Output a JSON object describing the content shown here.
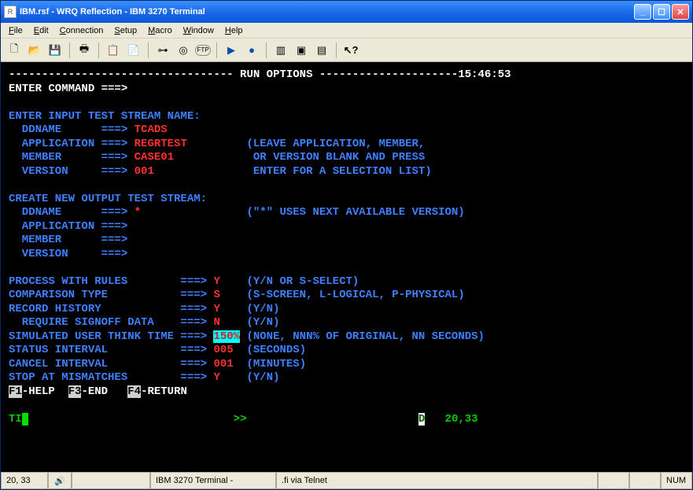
{
  "titlebar": {
    "text": "IBM.rsf - WRQ Reflection - IBM 3270 Terminal",
    "icon_label": "R"
  },
  "menus": {
    "file": {
      "u": "F",
      "rest": "ile"
    },
    "edit": {
      "u": "E",
      "rest": "dit"
    },
    "connection": {
      "u": "C",
      "rest": "onnection"
    },
    "setup": {
      "u": "S",
      "rest": "etup"
    },
    "macro": {
      "u": "M",
      "rest": "acro"
    },
    "window": {
      "u": "W",
      "rest": "indow"
    },
    "help": {
      "u": "H",
      "rest": "elp"
    }
  },
  "term": {
    "title": " RUN OPTIONS ",
    "time": "15:46:53",
    "cmd_label": "ENTER COMMAND ===>",
    "input_header": "ENTER INPUT TEST STREAM NAME:",
    "ddname_l": "  DDNAME      ===> ",
    "ddname_v": "TCADS",
    "app_l": "  APPLICATION ===> ",
    "app_v": "REGRTEST",
    "app_hint": "(LEAVE APPLICATION, MEMBER,",
    "mem_l": "  MEMBER      ===> ",
    "mem_v": "CASE01",
    "mem_hint": " OR VERSION BLANK AND PRESS",
    "ver_l": "  VERSION     ===> ",
    "ver_v": "001",
    "ver_hint": " ENTER FOR A SELECTION LIST)",
    "output_header": "CREATE NEW OUTPUT TEST STREAM:",
    "oddname_l": "  DDNAME      ===> ",
    "oddname_v": "*",
    "oddname_hint": "(\"*\" USES NEXT AVAILABLE VERSION)",
    "oapp_l": "  APPLICATION ===>",
    "omem_l": "  MEMBER      ===>",
    "over_l": "  VERSION     ===>",
    "procrule_l": "PROCESS WITH RULES        ===> ",
    "procrule_v": "Y",
    "procrule_h": "(Y/N OR S-SELECT)",
    "comp_l": "COMPARISON TYPE           ===> ",
    "comp_v": "S",
    "comp_h": "(S-SCREEN, L-LOGICAL, P-PHYSICAL)",
    "rec_l": "RECORD HISTORY            ===> ",
    "rec_v": "Y",
    "rec_h": "(Y/N)",
    "sign_l": "  REQUIRE SIGNOFF DATA    ===> ",
    "sign_v": "N",
    "sign_h": "(Y/N)",
    "think_l": "SIMULATED USER THINK TIME ===> ",
    "think_v": "150%",
    "think_h": "(NONE, NNN% OF ORIGINAL, NN SECONDS)",
    "stat_l": "STATUS INTERVAL           ===> ",
    "stat_v": "005",
    "stat_h": "(SECONDS)",
    "can_l": "CANCEL INTERVAL           ===> ",
    "can_v": "001",
    "can_h": "(MINUTES)",
    "stop_l": "STOP AT MISMATCHES        ===> ",
    "stop_v": "Y",
    "stop_h": "(Y/N)",
    "f1": "F1",
    "f1t": "-HELP  ",
    "f3": "F3",
    "f3t": "-END   ",
    "f4": "F4",
    "f4t": "-RETURN",
    "oia_ti": "TI",
    "oia_sym": ">>",
    "oia_d": "D",
    "oia_pos": "20,33"
  },
  "status": {
    "pos": "20, 33",
    "emu": "IBM 3270 Terminal - ",
    "conn": ".fi via Telnet",
    "num": "NUM"
  }
}
